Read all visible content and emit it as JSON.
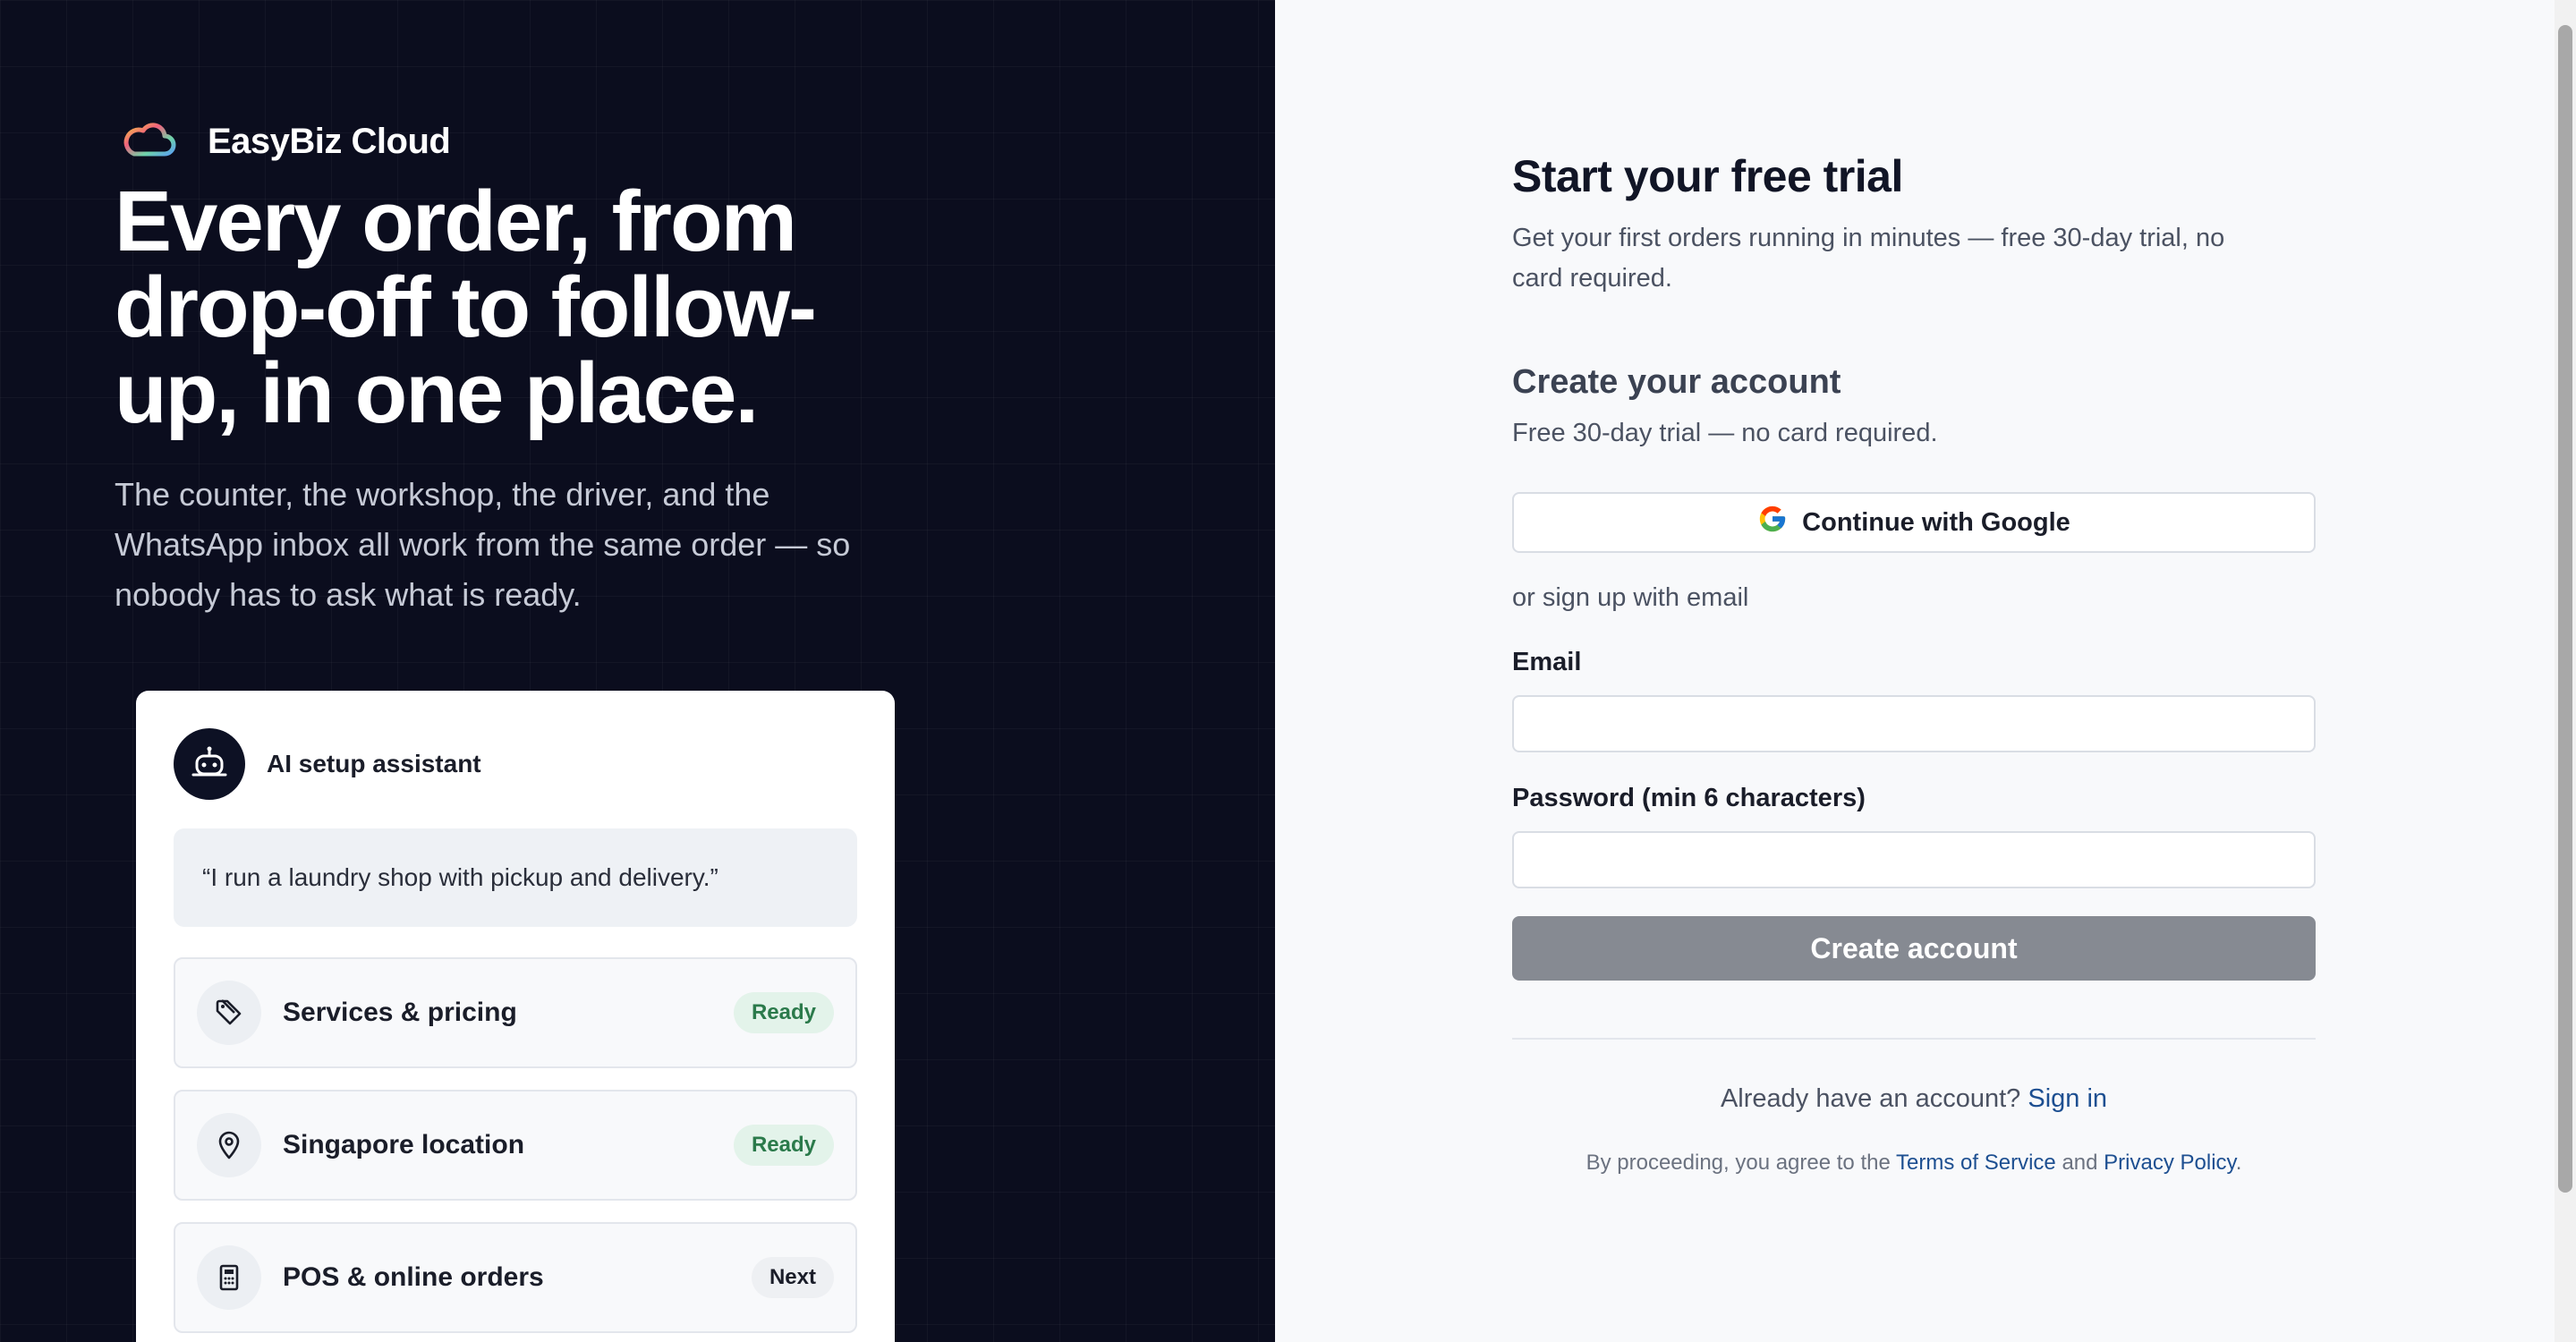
{
  "brand": {
    "name": "EasyBiz Cloud",
    "logo_icon": "cloud-gradient-icon"
  },
  "hero": {
    "title": "Every order, from drop-off to follow-up, in one place.",
    "subtitle": "The counter, the workshop, the driver, and the WhatsApp inbox all work from the same order — so nobody has to ask what is ready."
  },
  "assistant_card": {
    "label": "AI setup assistant",
    "icon": "robot-icon",
    "quote": "“I run a laundry shop with pickup and delivery.”",
    "steps": [
      {
        "label": "Services & pricing",
        "status": "Ready",
        "icon": "tag-icon"
      },
      {
        "label": "Singapore location",
        "status": "Ready",
        "icon": "map-pin-icon"
      },
      {
        "label": "POS & online orders",
        "status": "Next",
        "icon": "register-icon"
      }
    ]
  },
  "signup": {
    "title": "Start your free trial",
    "lead": "Get your first orders running in minutes — free 30-day trial, no card required.",
    "account_heading": "Create your account",
    "account_sub": "Free 30-day trial — no card required.",
    "google_button": "Continue with Google",
    "divider": "or sign up with email",
    "email_label": "Email",
    "email_value": "",
    "password_label": "Password (min 6 characters)",
    "password_value": "",
    "submit_button": "Create account",
    "signin_prompt": "Already have an account?",
    "signin_link": "Sign in",
    "legal_prefix": "By proceeding, you agree to the",
    "terms_link": "Terms of Service",
    "legal_and": "and",
    "privacy_link": "Privacy Policy",
    "legal_suffix": "."
  },
  "colors": {
    "left_background": "#0b0d1e",
    "submit_disabled": "#868a92",
    "link": "#1d4f91",
    "ready_pill_bg": "#e3f3ea",
    "ready_pill_text": "#2b7a4b"
  }
}
